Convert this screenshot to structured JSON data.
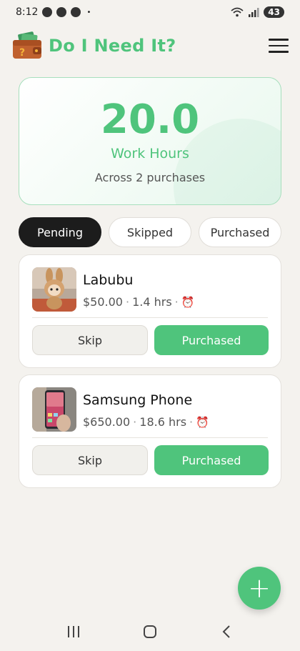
{
  "status_bar": {
    "time": "8:12",
    "dot": "•",
    "battery": "43",
    "icons": [
      "notification-icon",
      "messenger-icon",
      "messenger-icon",
      "wifi-icon",
      "signal-icon",
      "battery-icon"
    ]
  },
  "header": {
    "title": "Do I Need It?",
    "logo_icon": "wallet-logo-icon",
    "menu_icon": "hamburger-menu-icon"
  },
  "summary": {
    "hours": "20.0",
    "unit_label": "Work Hours",
    "subtitle": "Across 2 purchases"
  },
  "tabs": [
    {
      "label": "Pending",
      "active": true
    },
    {
      "label": "Skipped",
      "active": false
    },
    {
      "label": "Purchased",
      "active": false
    }
  ],
  "items": [
    {
      "name": "Labubu",
      "price": "$50.00",
      "hours": "1.4 hrs",
      "sep": "·",
      "alarm_icon": "alarm-clock-icon",
      "skip_label": "Skip",
      "purchased_label": "Purchased"
    },
    {
      "name": "Samsung Phone",
      "price": "$650.00",
      "hours": "18.6 hrs",
      "sep": "·",
      "alarm_icon": "alarm-clock-icon",
      "skip_label": "Skip",
      "purchased_label": "Purchased"
    }
  ],
  "fab": {
    "label": "+"
  },
  "colors": {
    "accent": "#4fc47c",
    "background": "#f4f2ee",
    "tab_active": "#1c1c1c"
  }
}
